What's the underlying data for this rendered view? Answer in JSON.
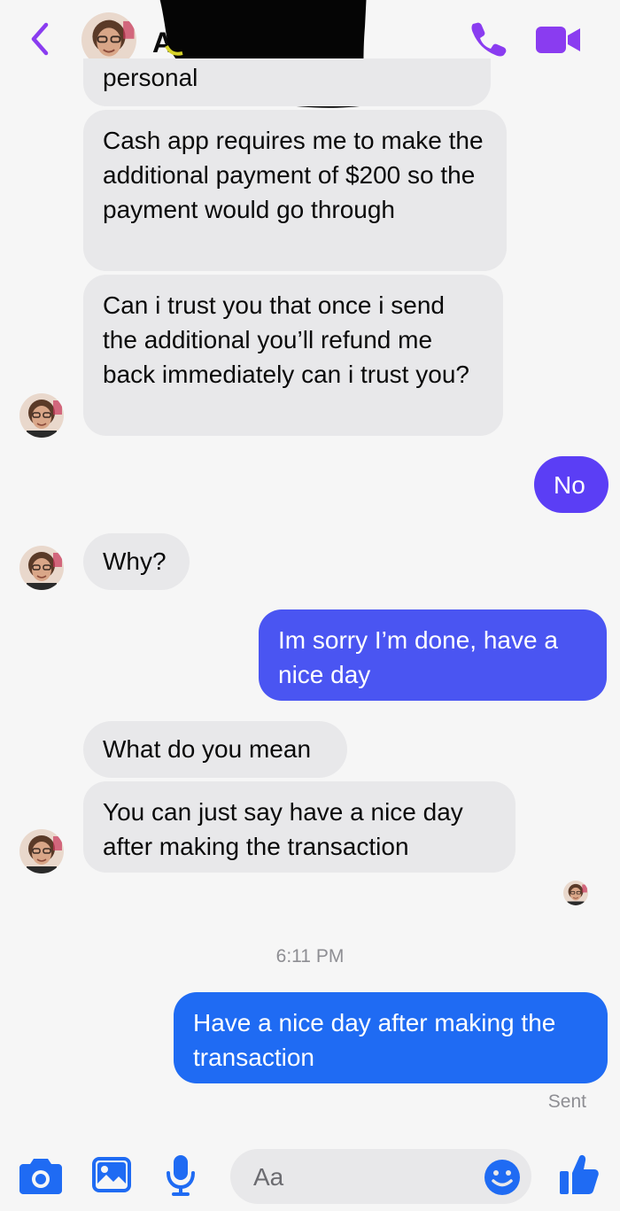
{
  "colors": {
    "accent": "#8a3cf0",
    "blue": "#1f6bf3",
    "outgoing_purple": "#5b3ef5",
    "incoming_bubble": "#e8e8ea"
  },
  "header": {
    "back_icon": "chevron-left-icon",
    "name_visible": "A",
    "call_icon": "phone-icon",
    "video_icon": "video-camera-icon"
  },
  "messages": [
    {
      "id": "m0",
      "direction": "incoming",
      "text": "personal"
    },
    {
      "id": "m1",
      "direction": "incoming",
      "text": "Cash app requires me to make the additional payment of $200 so the payment would go through"
    },
    {
      "id": "m2",
      "direction": "incoming",
      "text": "Can i trust you that once i send the additional you’ll refund me back immediately can i trust you?"
    },
    {
      "id": "m3",
      "direction": "outgoing",
      "text": "No"
    },
    {
      "id": "m4",
      "direction": "incoming",
      "text": "Why?"
    },
    {
      "id": "m5",
      "direction": "outgoing",
      "text": "Im sorry I’m done, have a nice day"
    },
    {
      "id": "m6",
      "direction": "incoming",
      "text": "What do you mean"
    },
    {
      "id": "m7",
      "direction": "incoming",
      "text": "You can just say have a nice day after making the transaction"
    },
    {
      "id": "m8",
      "direction": "outgoing",
      "text": "Have a nice day after making the transaction"
    }
  ],
  "timestamp": "6:11 PM",
  "status": "Sent",
  "composer": {
    "placeholder": "Aa",
    "icons": [
      "camera-icon",
      "photo-icon",
      "microphone-icon",
      "emoji-icon",
      "thumbs-up-icon"
    ]
  }
}
